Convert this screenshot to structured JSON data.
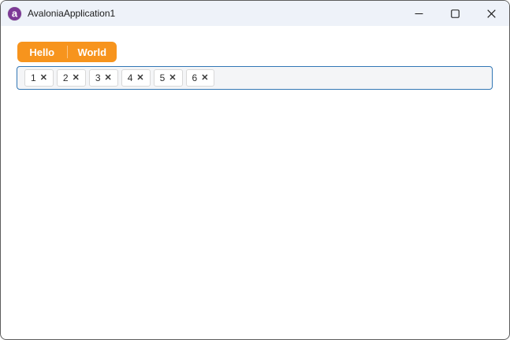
{
  "window": {
    "title": "AvaloniaApplication1",
    "app_icon_glyph": "a"
  },
  "colors": {
    "accent_orange": "#F7941D",
    "chipbox_border_blue": "#3277B5",
    "titlebar_bg": "#EEF2F9",
    "content_bg": "#FFFFFF"
  },
  "split_button": {
    "items": [
      {
        "label": "Hello"
      },
      {
        "label": "World"
      }
    ]
  },
  "chip_input": {
    "labels": [
      "1",
      "2",
      "3",
      "4",
      "5",
      "6"
    ],
    "remove_glyph": "✕"
  }
}
